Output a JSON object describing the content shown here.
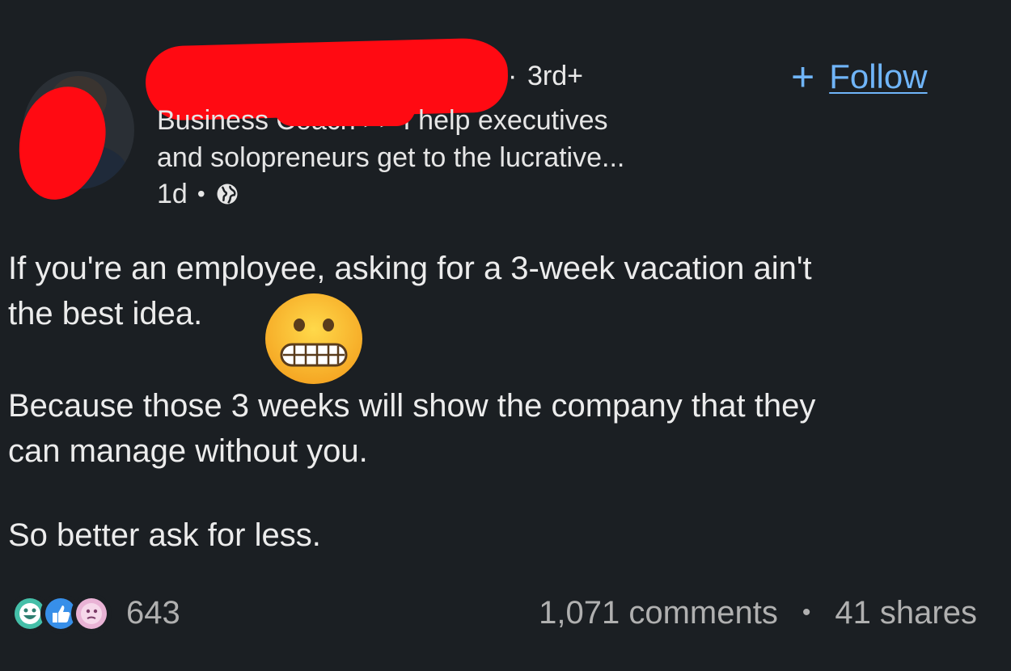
{
  "author": {
    "connection_degree": "3rd+",
    "headline_lines": [
      "Business Coach >> I help executives",
      "and solopreneurs get to the lucrative..."
    ],
    "time_ago": "1d",
    "visibility_icon": "globe-icon"
  },
  "follow": {
    "plus": "+",
    "label": "Follow",
    "color": "#70b5f9"
  },
  "post": {
    "paragraph1_line1": "If you're an employee, asking for a 3-week vacation ain't",
    "paragraph1_line2": "the best idea.",
    "emoji": "grimacing-face",
    "paragraph2_line1": "Because those 3 weeks will show the company that they",
    "paragraph2_line2": "can manage without you.",
    "paragraph3": "So better ask for less."
  },
  "social": {
    "reaction_icons": [
      "funny-icon",
      "like-icon",
      "curious-icon"
    ],
    "reactions_count": "643",
    "comments": "1,071 comments",
    "shares": "41 shares",
    "separator": "•"
  },
  "colors": {
    "background": "#1b1f23",
    "redaction": "#ff0a12",
    "link": "#70b5f9"
  }
}
